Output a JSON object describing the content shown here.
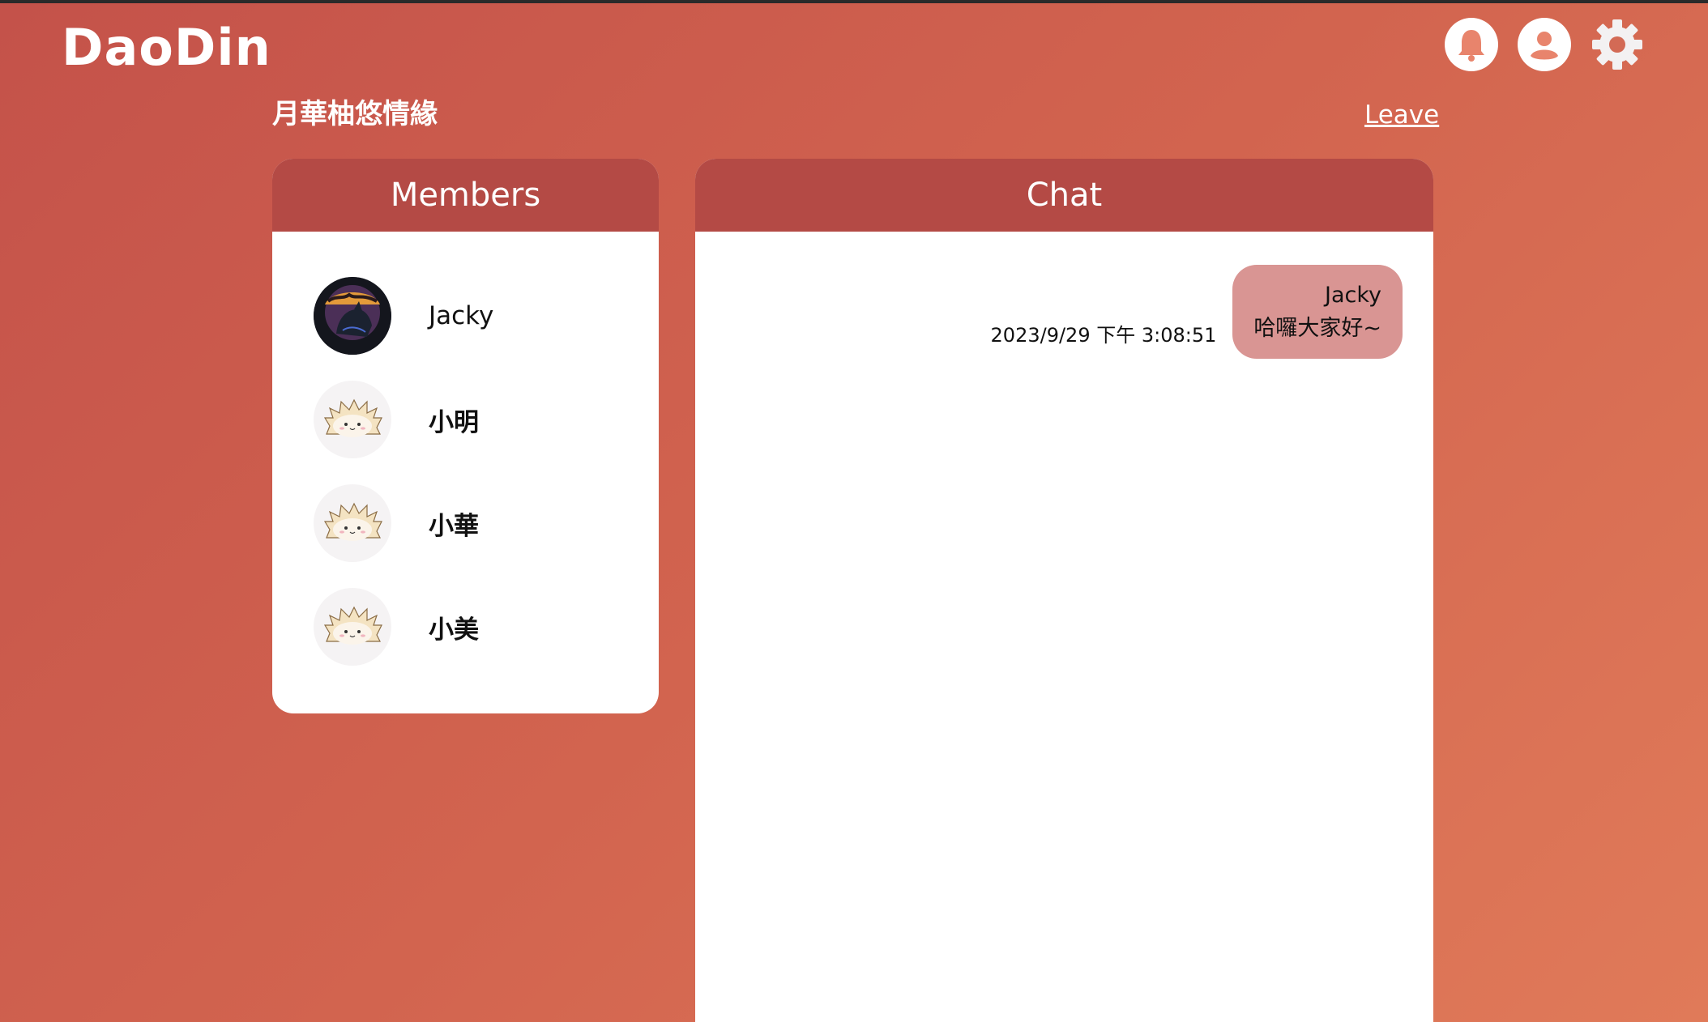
{
  "app": {
    "logo_text": "DaoDin"
  },
  "header": {
    "icons": [
      "bell-icon",
      "user-icon",
      "gear-icon"
    ]
  },
  "room": {
    "title": "月華柚悠情緣",
    "leave_label": "Leave"
  },
  "members_panel": {
    "title": "Members",
    "members": [
      {
        "name": "Jacky",
        "avatar": "wolf-avatar"
      },
      {
        "name": "小明",
        "avatar": "hedgehog-avatar"
      },
      {
        "name": "小華",
        "avatar": "hedgehog-avatar"
      },
      {
        "name": "小美",
        "avatar": "hedgehog-avatar"
      }
    ]
  },
  "chat_panel": {
    "title": "Chat",
    "messages": [
      {
        "sender": "Jacky",
        "text": "哈囉大家好~",
        "time": "2023/9/29 下午 3:08:51"
      }
    ]
  },
  "colors": {
    "accent": "#b44a45",
    "bubble": "#d99593",
    "bell": "#e8846c",
    "user_icon": "#e8846c"
  }
}
